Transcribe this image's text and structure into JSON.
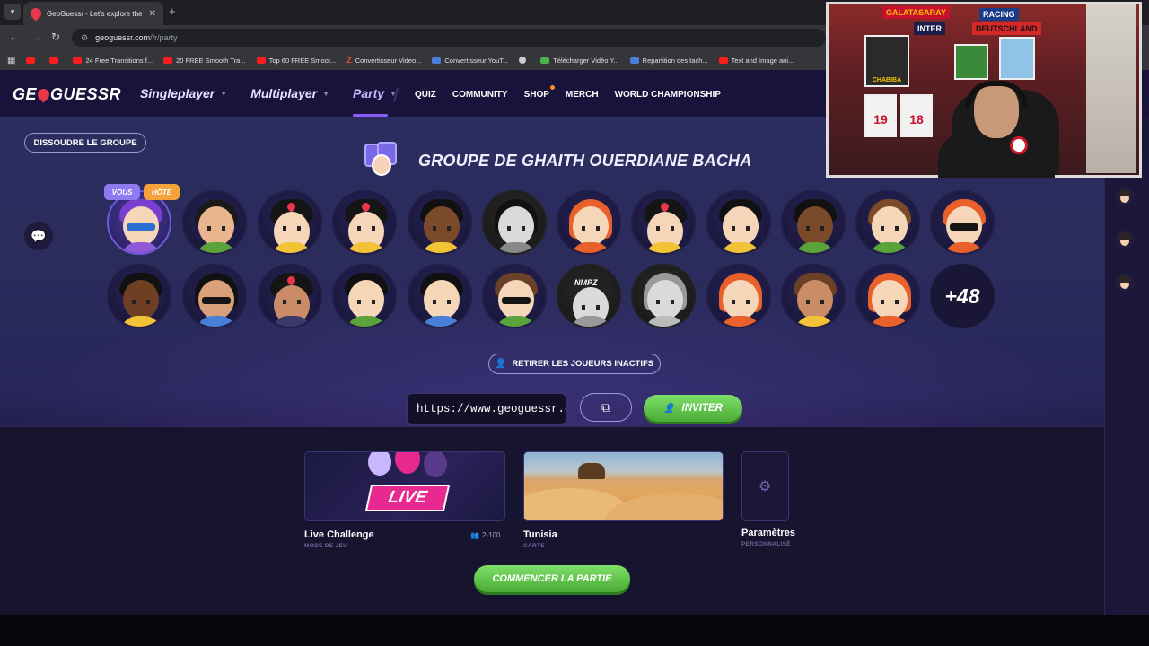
{
  "browser": {
    "tab_title": "GeoGuessr - Let's explore the w",
    "url_host": "geoguessr.com",
    "url_path": "/fr/party",
    "bookmarks": [
      {
        "icon": "youtube-icon",
        "label": ""
      },
      {
        "icon": "youtube-icon",
        "label": ""
      },
      {
        "icon": "youtube-icon",
        "label": "24 Free Transitions f..."
      },
      {
        "icon": "youtube-icon",
        "label": "20 FREE Smooth Tra..."
      },
      {
        "icon": "youtube-icon",
        "label": "Top 60 FREE Smoot..."
      },
      {
        "icon": "z-icon",
        "label": "Convertisseur Video..."
      },
      {
        "icon": "converter-icon",
        "label": "Convertisseur YouT..."
      },
      {
        "icon": "globe-icon",
        "label": ""
      },
      {
        "icon": "download-icon",
        "label": "Télécharger Vidéo Y..."
      },
      {
        "icon": "docs-icon",
        "label": "Repartition des tach..."
      },
      {
        "icon": "youtube-icon",
        "label": "Text and Image ani..."
      }
    ]
  },
  "header": {
    "logo_left": "GE",
    "logo_right": "GUESSR",
    "nav": [
      {
        "label": "Singleplayer",
        "active": false
      },
      {
        "label": "Multiplayer",
        "active": false
      },
      {
        "label": "Party",
        "active": true
      }
    ],
    "subnav": [
      "QUIZ",
      "COMMUNITY",
      "SHOP",
      "MERCH",
      "WORLD CHAMPIONSHIP"
    ]
  },
  "party": {
    "dissolve_label": "DISSOUDRE LE GROUPE",
    "title": "GROUPE DE GHAITH OUERDIANE BACHA",
    "badge_you": "VOUS",
    "badge_host": "HÔTE",
    "more_players": "+48",
    "remove_inactive_label": "RETIRER LES JOUEURS INACTIFS",
    "invite_url": "https://www.geoguessr.com/join",
    "invite_label": "INVITER",
    "start_label": "COMMENCER LA PARTIE"
  },
  "cards": {
    "mode_title": "Live Challenge",
    "mode_sub": "MODE DE JEU",
    "mode_players": "2-100",
    "mode_tag": "LIVE",
    "map_title": "Tunisia",
    "map_sub": "CARTE",
    "settings_title": "Paramètres",
    "settings_sub": "PERSONNALISÉ"
  },
  "webcam": {
    "banner_1": "GALATASARAY",
    "banner_2": "RACING",
    "banner_3": "DEUTSCHLAND",
    "banner_4": "INTER",
    "poster_name": "CHABIBA",
    "shirt_1": "19",
    "shirt_2": "18"
  },
  "colors": {
    "brand_red": "#e8364a",
    "accent_purple": "#8b5cf6",
    "green_button": "#5cc046",
    "host_badge": "#f5a23a",
    "you_badge": "#8f7bf0"
  }
}
